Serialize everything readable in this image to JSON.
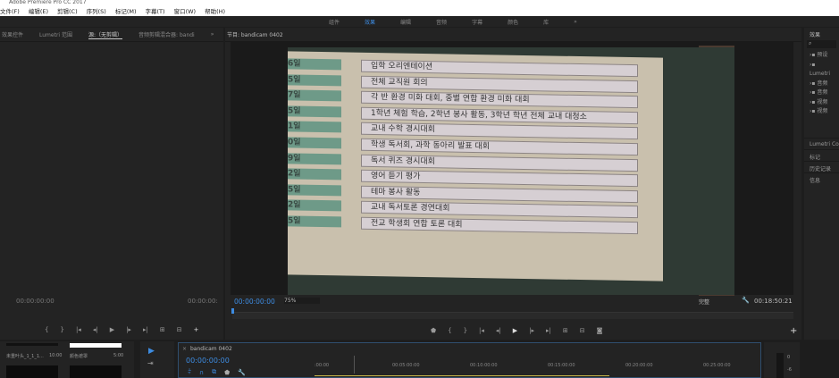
{
  "title": "Adobe Premiere Pro CC 2017",
  "menu": [
    "文件(F)",
    "编辑(E)",
    "剪辑(C)",
    "序列(S)",
    "标记(M)",
    "字幕(T)",
    "窗口(W)",
    "帮助(H)"
  ],
  "workspaces": [
    "组件",
    "效果",
    "编辑",
    "音频",
    "字幕",
    "颜色",
    "库",
    "»"
  ],
  "left_tabs": [
    "效果控件",
    "Lumetri 范围",
    "源:（无剪辑）",
    "音频剪辑混合器: bandi",
    "»"
  ],
  "source": {
    "tc_left": "00:00:00:00",
    "tc_right": "00:00:00:"
  },
  "program": {
    "tab": "节目: bandicam 0402",
    "tc": "00:00:00:00",
    "zoom": "75%",
    "quality": "完整",
    "duration": "00:18:50:21"
  },
  "video_rows": [
    {
      "d": "6일",
      "t": "입학 오리엔테이션"
    },
    {
      "d": "5일",
      "t": "전체 교직원 회의"
    },
    {
      "d": "7일",
      "t": "각 반 환경 미화 대회, 중별 연합 환경 미화 대회"
    },
    {
      "d": "5일",
      "t": "1학년 체험 학습, 2학년 봉사 활동, 3학년 학년 전체 교내 대청소"
    },
    {
      "d": "1일",
      "t": "교내 수학 경시대회"
    },
    {
      "d": "0일",
      "t": "학생 독서회, 과학 동아리 발표 대회"
    },
    {
      "d": "9일",
      "t": "독서 퀴즈 경시대회"
    },
    {
      "d": "2일",
      "t": "영어 듣기 평가"
    },
    {
      "d": "5일",
      "t": "테마 봉사 활동"
    },
    {
      "d": "2일",
      "t": "교내 독서토론 경연대회"
    },
    {
      "d": "5일",
      "t": "전교 학생회 연합 토론 대회"
    }
  ],
  "right": {
    "title": "效果",
    "items": [
      "预设",
      "Lumetri",
      "音频",
      "音频",
      "视频",
      "视频"
    ],
    "sections": [
      "Lumetri Color",
      "标记",
      "历史记录",
      "信息"
    ]
  },
  "bin": [
    {
      "name": "未重叶头_1_1_1...",
      "dur": "10:00"
    },
    {
      "name": "颜色遮罩",
      "dur": "5:00"
    }
  ],
  "timeline": {
    "tab": "bandicam 0402",
    "tc": "00:00:00:00",
    "ruler": [
      ":00:00",
      "00:05:00:00",
      "00:10:00:00",
      "00:15:00:00",
      "00:20:00:00",
      "00:25:00:00"
    ]
  },
  "meter": [
    "0",
    "-6"
  ]
}
